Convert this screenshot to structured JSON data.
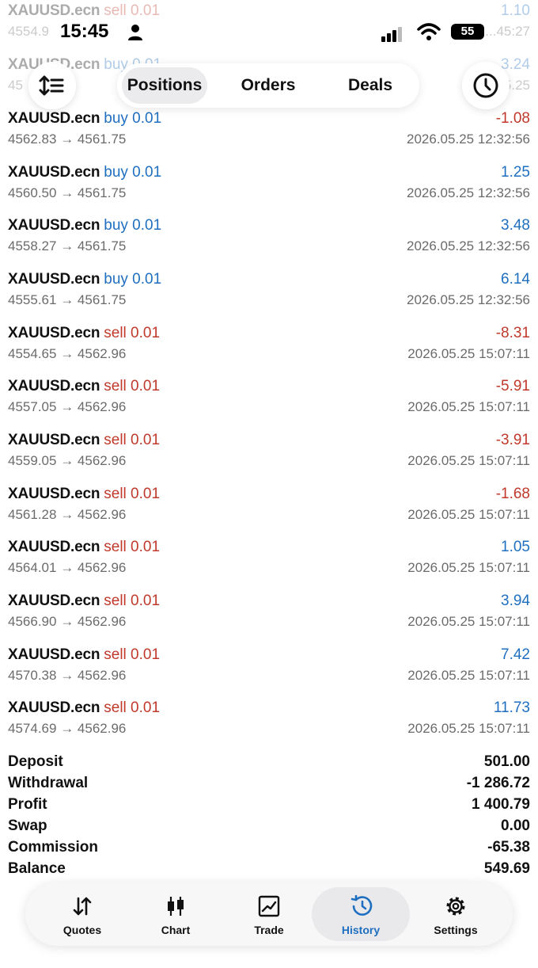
{
  "status_bar": {
    "time": "15:45",
    "battery": "55"
  },
  "toolbar": {
    "tabs": [
      "Positions",
      "Orders",
      "Deals"
    ],
    "active_tab": 0
  },
  "trades": [
    {
      "symbol": "XAUUSD.ecn",
      "side": "sell",
      "volume": "0.01",
      "price_open": "4554.9",
      "price_close": "",
      "profit": "1.10",
      "time": "...45:27",
      "partial": true
    },
    {
      "symbol": "XAUUSD.ecn",
      "side": "buy",
      "volume": "0.01",
      "price_open": "45",
      "price_close": "456",
      "profit": "3.24",
      "time": "05.25",
      "partial": true
    },
    {
      "symbol": "XAUUSD.ecn",
      "side": "buy",
      "volume": "0.01",
      "price_open": "4562.83",
      "price_close": "4561.75",
      "profit": "-1.08",
      "time": "2026.05.25 12:32:56"
    },
    {
      "symbol": "XAUUSD.ecn",
      "side": "buy",
      "volume": "0.01",
      "price_open": "4560.50",
      "price_close": "4561.75",
      "profit": "1.25",
      "time": "2026.05.25 12:32:56"
    },
    {
      "symbol": "XAUUSD.ecn",
      "side": "buy",
      "volume": "0.01",
      "price_open": "4558.27",
      "price_close": "4561.75",
      "profit": "3.48",
      "time": "2026.05.25 12:32:56"
    },
    {
      "symbol": "XAUUSD.ecn",
      "side": "buy",
      "volume": "0.01",
      "price_open": "4555.61",
      "price_close": "4561.75",
      "profit": "6.14",
      "time": "2026.05.25 12:32:56"
    },
    {
      "symbol": "XAUUSD.ecn",
      "side": "sell",
      "volume": "0.01",
      "price_open": "4554.65",
      "price_close": "4562.96",
      "profit": "-8.31",
      "time": "2026.05.25 15:07:11"
    },
    {
      "symbol": "XAUUSD.ecn",
      "side": "sell",
      "volume": "0.01",
      "price_open": "4557.05",
      "price_close": "4562.96",
      "profit": "-5.91",
      "time": "2026.05.25 15:07:11"
    },
    {
      "symbol": "XAUUSD.ecn",
      "side": "sell",
      "volume": "0.01",
      "price_open": "4559.05",
      "price_close": "4562.96",
      "profit": "-3.91",
      "time": "2026.05.25 15:07:11"
    },
    {
      "symbol": "XAUUSD.ecn",
      "side": "sell",
      "volume": "0.01",
      "price_open": "4561.28",
      "price_close": "4562.96",
      "profit": "-1.68",
      "time": "2026.05.25 15:07:11"
    },
    {
      "symbol": "XAUUSD.ecn",
      "side": "sell",
      "volume": "0.01",
      "price_open": "4564.01",
      "price_close": "4562.96",
      "profit": "1.05",
      "time": "2026.05.25 15:07:11"
    },
    {
      "symbol": "XAUUSD.ecn",
      "side": "sell",
      "volume": "0.01",
      "price_open": "4566.90",
      "price_close": "4562.96",
      "profit": "3.94",
      "time": "2026.05.25 15:07:11"
    },
    {
      "symbol": "XAUUSD.ecn",
      "side": "sell",
      "volume": "0.01",
      "price_open": "4570.38",
      "price_close": "4562.96",
      "profit": "7.42",
      "time": "2026.05.25 15:07:11"
    },
    {
      "symbol": "XAUUSD.ecn",
      "side": "sell",
      "volume": "0.01",
      "price_open": "4574.69",
      "price_close": "4562.96",
      "profit": "11.73",
      "time": "2026.05.25 15:07:11"
    }
  ],
  "summary": [
    {
      "label": "Deposit",
      "value": "501.00"
    },
    {
      "label": "Withdrawal",
      "value": "-1 286.72"
    },
    {
      "label": "Profit",
      "value": "1 400.79"
    },
    {
      "label": "Swap",
      "value": "0.00"
    },
    {
      "label": "Commission",
      "value": "-65.38"
    },
    {
      "label": "Balance",
      "value": "549.69"
    }
  ],
  "nav": {
    "items": [
      {
        "label": "Quotes",
        "icon": "quotes-arrows-icon"
      },
      {
        "label": "Chart",
        "icon": "candlestick-icon"
      },
      {
        "label": "Trade",
        "icon": "trade-chart-icon"
      },
      {
        "label": "History",
        "icon": "history-clock-icon"
      },
      {
        "label": "Settings",
        "icon": "gear-icon"
      }
    ],
    "active": 3
  },
  "colors": {
    "buy": "#1f6fc0",
    "sell": "#c0392b",
    "active_nav": "#1f6fc0"
  }
}
